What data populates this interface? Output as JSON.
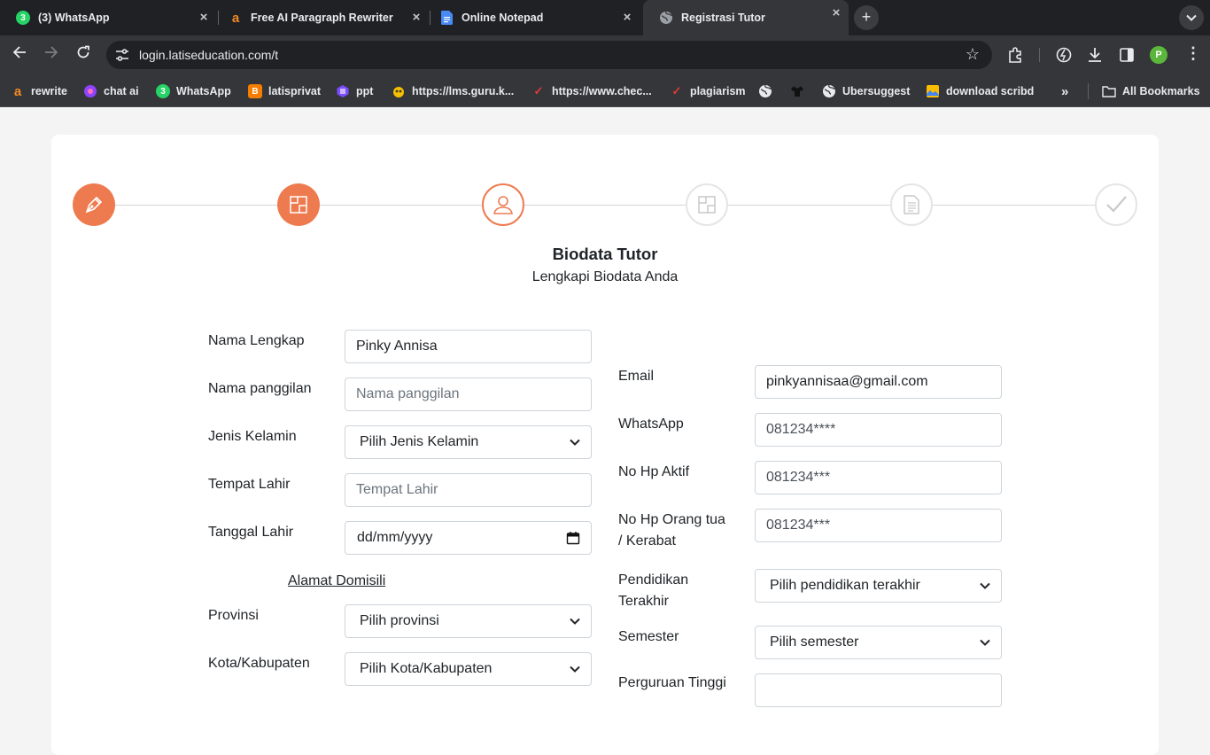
{
  "browser": {
    "tabs": [
      {
        "title": "(3) WhatsApp",
        "icon": "whatsapp-icon",
        "badge": "3"
      },
      {
        "title": "Free AI Paragraph Rewriter",
        "icon": "rewriter-icon",
        "badge": "a"
      },
      {
        "title": "Online Notepad",
        "icon": "document-icon",
        "badge": ""
      },
      {
        "title": "Registrasi Tutor",
        "icon": "globe-icon",
        "badge": ""
      }
    ],
    "url": "login.latiseducation.com/t",
    "profile_initial": "P",
    "bookmarks": [
      {
        "label": "rewrite",
        "icon": "rewriter-icon"
      },
      {
        "label": "chat ai",
        "icon": "chat-ai-icon"
      },
      {
        "label": "WhatsApp",
        "icon": "whatsapp-icon"
      },
      {
        "label": "latisprivat",
        "icon": "blogger-icon"
      },
      {
        "label": "ppt",
        "icon": "ppt-icon"
      },
      {
        "label": "https://lms.guru.k...",
        "icon": "lms-icon"
      },
      {
        "label": "https://www.chec...",
        "icon": "check-icon"
      },
      {
        "label": "plagiarism",
        "icon": "check-icon"
      },
      {
        "label": "",
        "icon": "globe-icon"
      },
      {
        "label": "",
        "icon": "shirt-icon"
      },
      {
        "label": "Ubersuggest",
        "icon": "globe-icon"
      },
      {
        "label": "download scribd",
        "icon": "scribd-icon"
      }
    ],
    "overflow": "»",
    "all_bookmarks": "All Bookmarks"
  },
  "colors": {
    "accent": "#ee7b50",
    "border": "#ced4da",
    "placeholder": "#6c757d"
  },
  "stepper": {
    "steps": [
      {
        "icon": "pen-icon",
        "state": "done"
      },
      {
        "icon": "layout-icon",
        "state": "done"
      },
      {
        "icon": "person-icon",
        "state": "current"
      },
      {
        "icon": "layout-icon",
        "state": "todo"
      },
      {
        "icon": "document-icon",
        "state": "todo"
      },
      {
        "icon": "check-icon",
        "state": "todo"
      }
    ]
  },
  "form": {
    "title": "Biodata Tutor",
    "subtitle": "Lengkapi Biodata Anda",
    "left": {
      "nama_lengkap": {
        "label": "Nama Lengkap",
        "value": "Pinky Annisa",
        "placeholder": ""
      },
      "nama_panggilan": {
        "label": "Nama panggilan",
        "value": "",
        "placeholder": "Nama panggilan"
      },
      "jenis_kelamin": {
        "label": "Jenis Kelamin",
        "selected": "Pilih Jenis Kelamin"
      },
      "tempat_lahir": {
        "label": "Tempat Lahir",
        "value": "",
        "placeholder": "Tempat Lahir"
      },
      "tanggal_lahir": {
        "label": "Tanggal Lahir",
        "placeholder": "dd/mm/yyyy"
      },
      "section_alamat": "Alamat Domisili",
      "provinsi": {
        "label": "Provinsi",
        "selected": "Pilih provinsi"
      },
      "kota": {
        "label": "Kota/Kabupaten",
        "selected": "Pilih Kota/Kabupaten"
      }
    },
    "right": {
      "email": {
        "label": "Email",
        "value": "pinkyannisaa@gmail.com"
      },
      "whatsapp": {
        "label": "WhatsApp",
        "value": "081234****"
      },
      "no_hp_aktif": {
        "label": "No Hp Aktif",
        "value": "081234***"
      },
      "no_hp_ortu": {
        "label_line1": "No Hp Orang tua",
        "label_line2": "/ Kerabat",
        "value": "081234***"
      },
      "pendidikan": {
        "label_line1": "Pendidikan",
        "label_line2": "Terakhir",
        "selected": "Pilih pendidikan terakhir"
      },
      "semester": {
        "label": "Semester",
        "selected": "Pilih semester"
      },
      "next_label_partial": "Perguruan Tinggi"
    }
  }
}
